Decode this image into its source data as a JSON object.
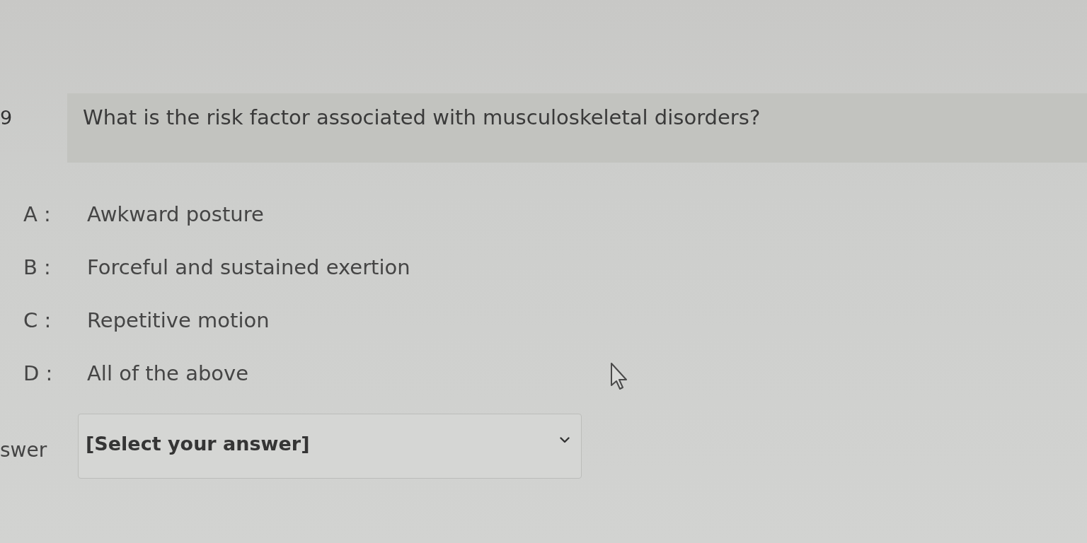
{
  "question": {
    "number": "9",
    "text": "What is the risk factor associated with musculoskeletal disorders?"
  },
  "options": [
    {
      "letter": "A :",
      "text": "Awkward posture"
    },
    {
      "letter": "B :",
      "text": "Forceful and sustained exertion"
    },
    {
      "letter": "C :",
      "text": "Repetitive motion"
    },
    {
      "letter": "D :",
      "text": "All of the above"
    }
  ],
  "answer": {
    "label": "swer",
    "placeholder": "[Select your answer]"
  }
}
